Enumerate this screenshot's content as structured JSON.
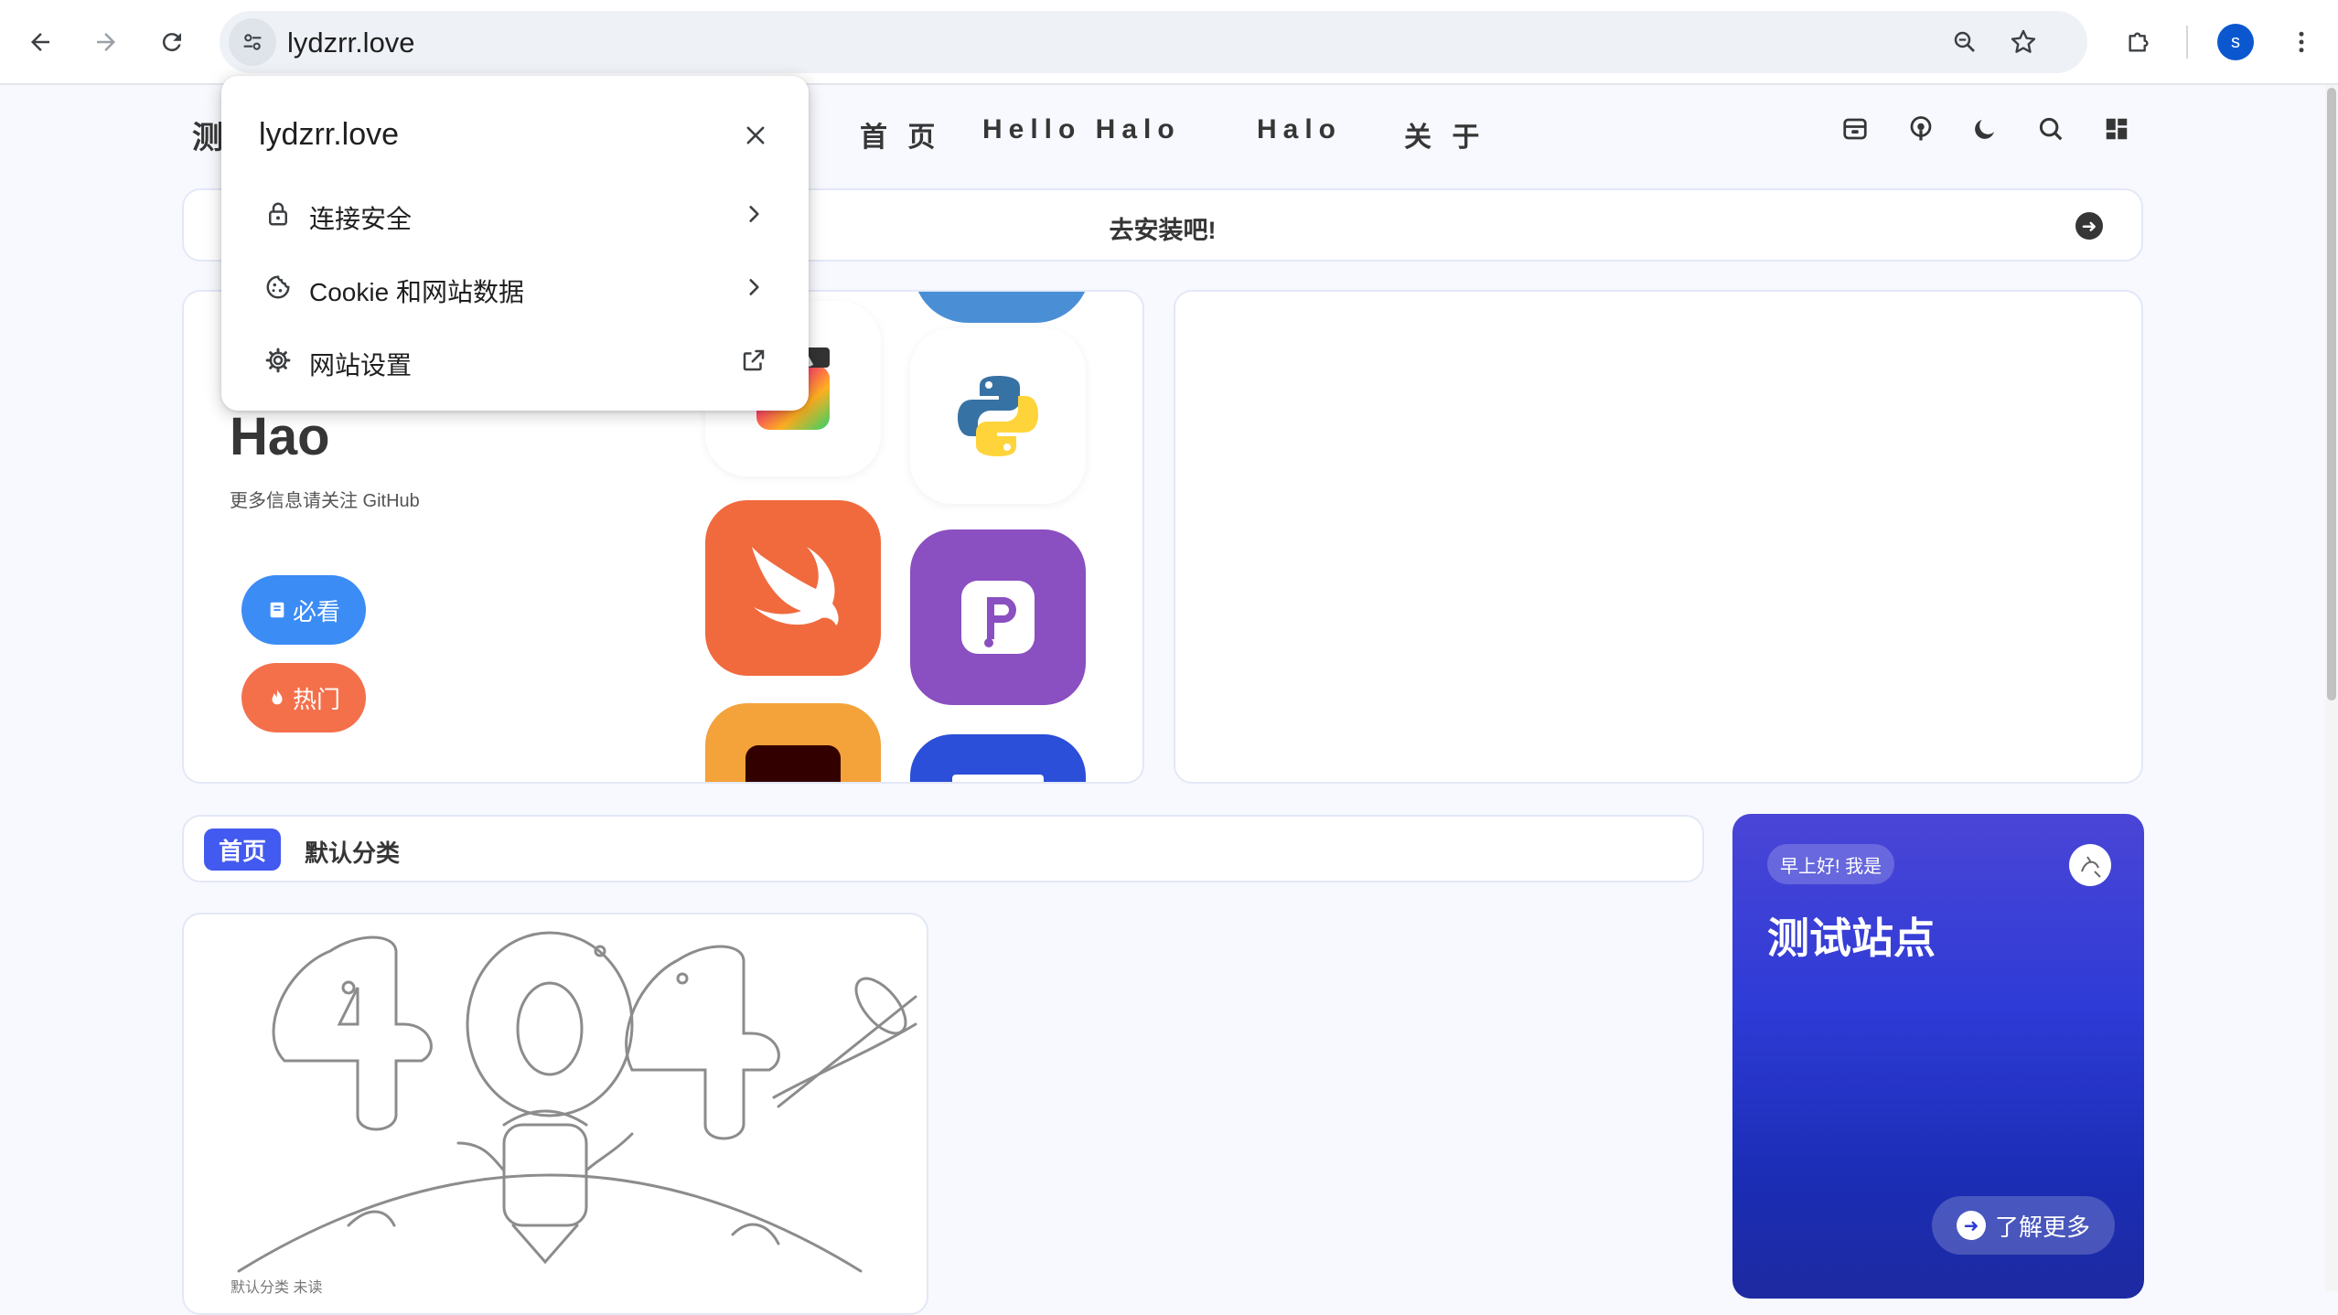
{
  "browser": {
    "url": "lydzrr.love",
    "profile_initial": "s"
  },
  "site_header": {
    "logo_text": "测",
    "nav": [
      {
        "label": "首 页"
      },
      {
        "label": "Hello Halo"
      },
      {
        "label": "Halo"
      },
      {
        "label": "关 于"
      }
    ]
  },
  "notice": {
    "text": "去安装吧!"
  },
  "hero": {
    "title": "Hao",
    "subtitle": "更多信息请关注 GitHub",
    "buttons": [
      {
        "label": "必看",
        "icon": "book-icon",
        "color": "#3b8cf5"
      },
      {
        "label": "热门",
        "icon": "fire-icon",
        "color": "#f4704b"
      }
    ]
  },
  "categories": {
    "active": "首页",
    "items": [
      "默认分类"
    ]
  },
  "post": {
    "meta": "默认分类 未读"
  },
  "author_card": {
    "greeting": "早上好! 我是",
    "name": "测试站点",
    "more_label": "了解更多"
  },
  "site_info_popup": {
    "title": "lydzrr.love",
    "rows": [
      {
        "label": "连接安全",
        "icon": "lock-icon"
      },
      {
        "label": "Cookie 和网站数据",
        "icon": "cookie-icon"
      },
      {
        "label": "网站设置",
        "icon": "gear-icon"
      }
    ]
  },
  "colors": {
    "accent": "#425aef",
    "page_bg": "#f7f9fe",
    "author_card": "#2e3bd6"
  }
}
